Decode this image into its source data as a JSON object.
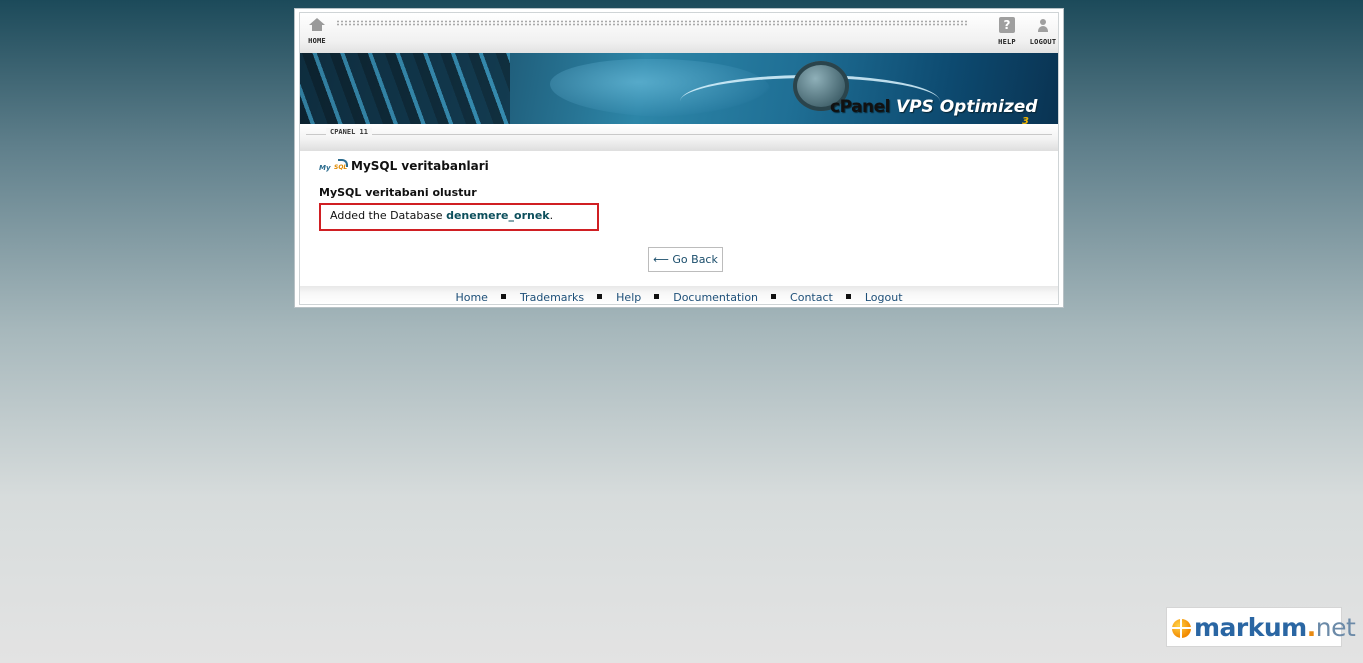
{
  "toolbar": {
    "home_label": "HOME",
    "help_label": "HELP",
    "help_glyph": "?",
    "logout_label": "LOGOUT",
    "icons": [
      "home-icon",
      "help-icon",
      "logout-icon"
    ]
  },
  "banner": {
    "logo_panel": "cPanel",
    "logo_tail": "VPS Optimized",
    "logo_version": "3"
  },
  "breadcrumb": {
    "label": "CPANEL 11"
  },
  "page": {
    "icon_text": "My",
    "icon_text2": "SQL",
    "title": "MySQL veritabanlari",
    "subtitle": "MySQL veritabani olustur",
    "message_prefix": "Added the Database ",
    "database_name": "denemere_ornek",
    "message_suffix": ".",
    "go_back_label": "⟵ Go Back"
  },
  "footer": {
    "links": [
      "Home",
      "Trademarks",
      "Help",
      "Documentation",
      "Contact",
      "Logout"
    ]
  },
  "watermark": {
    "brand": "markum",
    "tld": "net"
  },
  "colors": {
    "link": "#1d4f78",
    "highlight_border": "#d01f23",
    "database_name": "#0d4f5c"
  }
}
